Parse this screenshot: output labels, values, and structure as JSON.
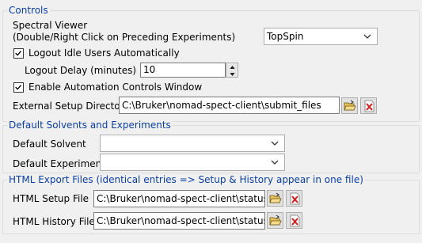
{
  "controls": {
    "title": "Controls",
    "spectral_viewer_label_line1": "Spectral Viewer",
    "spectral_viewer_label_line2": "(Double/Right Click on Preceding Experiments)",
    "spectral_viewer_value": "TopSpin",
    "logout_idle_label": "Logout Idle Users Automatically",
    "logout_idle_checked": true,
    "logout_delay_label": "Logout Delay (minutes)",
    "logout_delay_value": "10",
    "enable_automation_label": "Enable Automation Controls Window",
    "enable_automation_checked": true,
    "external_setup_label": "External Setup Directory",
    "external_setup_value": "C:\\Bruker\\nomad-spect-client\\submit_files"
  },
  "solvents": {
    "title": "Default Solvents and Experiments",
    "default_solvent_label": "Default Solvent",
    "default_solvent_value": "",
    "default_experiment_label": "Default Experiment",
    "default_experiment_value": ""
  },
  "html_export": {
    "title": "HTML Export Files (identical entries => Setup & History appear in one file)",
    "setup_label": "HTML Setup File",
    "setup_value": "C:\\Bruker\\nomad-spect-client\\status_fil",
    "history_label": "HTML History File",
    "history_value": "C:\\Bruker\\nomad-spect-client\\status_fil"
  },
  "icons": {
    "folder": "open-folder-icon",
    "clear": "clear-red-x-icon",
    "dropdown": "chevron-down-icon"
  },
  "colors": {
    "group_title": "#0a3fa6",
    "background": "#f0f0f0"
  }
}
